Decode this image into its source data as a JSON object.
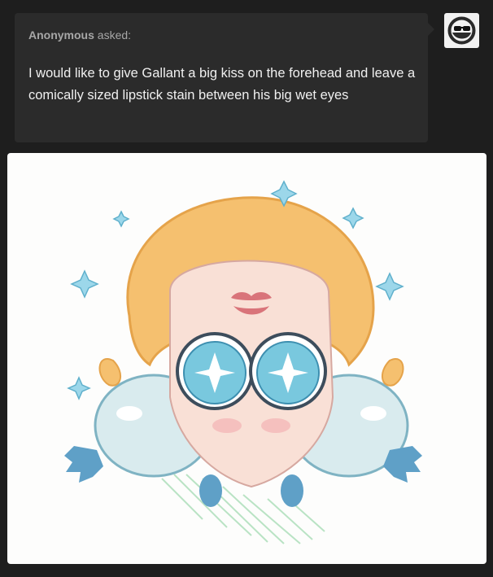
{
  "ask": {
    "asker": "Anonymous",
    "verb": "asked:",
    "text": "I would like to give Gallant a big kiss on the forehead and leave a comically sized lipstick stain between his big wet eyes"
  },
  "answer": {
    "image_icon": "chibi-character-illustration",
    "avatar_icon": "sunglasses-avatar-icon"
  },
  "colors": {
    "page_bg": "#1e1e1e",
    "bubble_bg": "#2b2b2b",
    "bubble_text": "#f0f0f0",
    "meta_text": "#a7a7a7",
    "hair": "#f5c06f",
    "eyes": "#79c8de",
    "lipstick": "#d9747a"
  }
}
